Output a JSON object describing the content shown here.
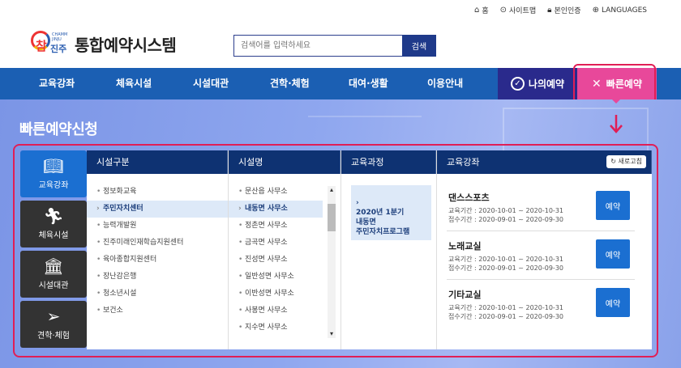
{
  "util": {
    "home": "홈",
    "sitemap": "사이트맵",
    "auth": "본인인증",
    "languages": "LANGUAGES"
  },
  "logo": {
    "mark_main": "참",
    "mark_sub": "진주",
    "mark_eng": "CHAMM JINJU",
    "title": "통합예약시스템"
  },
  "search": {
    "placeholder": "검색어를 입력하세요",
    "button": "검색"
  },
  "gnb": {
    "items": [
      "교육강좌",
      "체육시설",
      "시설대관",
      "견학·체험",
      "대여·생활",
      "이용안내"
    ],
    "my": "나의예약",
    "quick": "빠른예약"
  },
  "page": {
    "title": "빠른예약신청"
  },
  "tabs": [
    {
      "label": "교육강좌",
      "icon": "book-icon"
    },
    {
      "label": "체육시설",
      "icon": "runner-icon"
    },
    {
      "label": "시설대관",
      "icon": "building-icon"
    },
    {
      "label": "견학·체험",
      "icon": "paper-plane-icon"
    }
  ],
  "columns": {
    "category": {
      "header": "시설구분",
      "items": [
        "정보화교육",
        "주민자치센터",
        "능력개발원",
        "진주미래인재학습지원센터",
        "육아종합지원센터",
        "장난감은행",
        "청소년시설",
        "보건소"
      ],
      "selected": 1
    },
    "facility": {
      "header": "시설명",
      "items": [
        "문산읍 사무소",
        "내동면 사무소",
        "정촌면 사무소",
        "금곡면 사무소",
        "진성면 사무소",
        "일반성면 사무소",
        "이반성면 사무소",
        "사봉면 사무소",
        "지수면 사무소"
      ],
      "selected": 1
    },
    "course": {
      "header": "교육과정",
      "item": "2020년 1분기\n내동면\n주민자치프로그램"
    },
    "lecture": {
      "header": "교육강좌",
      "refresh": "새로고침",
      "cards": [
        {
          "name": "댄스스포츠",
          "edu": "교육기간 : 2020-10-01 ~ 2020-10-31",
          "reg": "접수기간 : 2020-09-01 ~ 2020-09-30",
          "button": "예약"
        },
        {
          "name": "노래교실",
          "edu": "교육기간 : 2020-10-01 ~ 2020-10-31",
          "reg": "접수기간 : 2020-09-01 ~ 2020-09-30",
          "button": "예약"
        },
        {
          "name": "기타교실",
          "edu": "교육기간 : 2020-10-01 ~ 2020-10-31",
          "reg": "접수기간 : 2020-09-01 ~ 2020-09-30",
          "button": "예약"
        }
      ]
    }
  },
  "colors": {
    "nav": "#1b5fb3",
    "my": "#2a2a8c",
    "quick": "#e8489a",
    "highlight": "#e01e56",
    "header": "#0e3272",
    "active_tab": "#1b6fd1"
  }
}
